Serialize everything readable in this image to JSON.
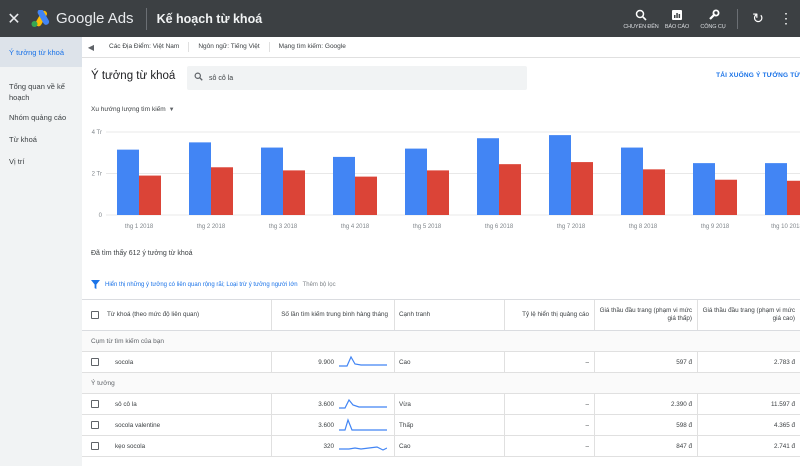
{
  "topbar": {
    "close_glyph": "✕",
    "brand": "Google Ads",
    "page": "Kế hoạch từ khoá",
    "tools": [
      {
        "icon": "search-icon",
        "label": "CHUYỂN ĐẾN"
      },
      {
        "icon": "reports-icon",
        "label": "BÁO CÁO"
      },
      {
        "icon": "wrench-icon",
        "label": "CÔNG CỤ"
      }
    ],
    "refresh_glyph": "↻",
    "more_glyph": "⋮"
  },
  "sidebar": {
    "items": [
      {
        "label": "Ý tưởng từ khoá",
        "active": true
      },
      {
        "label": "Tổng quan về kế hoạch"
      },
      {
        "label": "Nhóm quảng cáo"
      },
      {
        "label": "Từ khoá"
      },
      {
        "label": "Vị trí"
      }
    ]
  },
  "filterbar": {
    "back_glyph": "◀",
    "chips": [
      "Các Địa Điểm: Việt Nam",
      "Ngôn ngữ: Tiếng Việt",
      "Mạng tìm kiếm: Google"
    ]
  },
  "main": {
    "title": "Ý tưởng từ khoá",
    "search_value": "sô cô la",
    "download_label": "TẢI XUỐNG Ý TƯỞNG TỪ",
    "chart_dropdown": "Xu hướng lượng tìm kiếm",
    "results_text": "Đã tìm thấy 612 ý tưởng từ khoá",
    "filter_link": "Hiển thị những ý tưởng có liên quan rộng rãi; Loại trừ ý tưởng người lớn",
    "filter_add": "Thêm bộ lọc"
  },
  "colors": {
    "series_blue": "#4285f4",
    "series_red": "#db4437",
    "accent": "#1a73e8"
  },
  "chart_data": {
    "type": "bar",
    "categories": [
      "thg 1 2018",
      "thg 2 2018",
      "thg 3 2018",
      "thg 4 2018",
      "thg 5 2018",
      "thg 6 2018",
      "thg 7 2018",
      "thg 8 2018",
      "thg 9 2018",
      "thg 10 2018"
    ],
    "series": [
      {
        "values": [
          3.15,
          3.5,
          3.25,
          2.8,
          3.2,
          3.7,
          3.85,
          3.25,
          2.5,
          2.5
        ]
      },
      {
        "values": [
          1.9,
          2.3,
          2.15,
          1.85,
          2.15,
          2.45,
          2.55,
          2.2,
          1.7,
          1.65
        ]
      }
    ],
    "yticks": [
      {
        "value": 0,
        "label": "0"
      },
      {
        "value": 2,
        "label": "2 Tr"
      },
      {
        "value": 4,
        "label": "4 Tr"
      }
    ],
    "ylim": [
      0,
      4
    ],
    "grid": true
  },
  "table": {
    "headers": {
      "keyword": "Từ khoá (theo mức độ liên quan)",
      "volume": "Số lần tìm kiếm trung bình hàng tháng",
      "competition": "Cạnh tranh",
      "impression_share": "Tỷ lệ hiển thị quảng cáo",
      "bid_low": "Giá thầu đầu trang (phạm vi mức giá thấp)",
      "bid_high": "Giá thầu đầu trang (phạm vi mức giá cao)"
    },
    "group_provided": "Cụm từ tìm kiếm của bạn",
    "group_ideas": "Ý tưởng",
    "provided_rows": [
      {
        "keyword": "socola",
        "volume": "9.900",
        "competition": "Cao",
        "impression": "–",
        "low": "597 đ",
        "high": "2.783 đ"
      }
    ],
    "idea_rows": [
      {
        "keyword": "sô cô la",
        "volume": "3.600",
        "competition": "Vừa",
        "impression": "–",
        "low": "2.390 đ",
        "high": "11.597 đ"
      },
      {
        "keyword": "socola valentine",
        "volume": "3.600",
        "competition": "Thấp",
        "impression": "–",
        "low": "598 đ",
        "high": "4.365 đ"
      },
      {
        "keyword": "kẹo socola",
        "volume": "320",
        "competition": "Cao",
        "impression": "–",
        "low": "847 đ",
        "high": "2.741 đ"
      }
    ]
  }
}
